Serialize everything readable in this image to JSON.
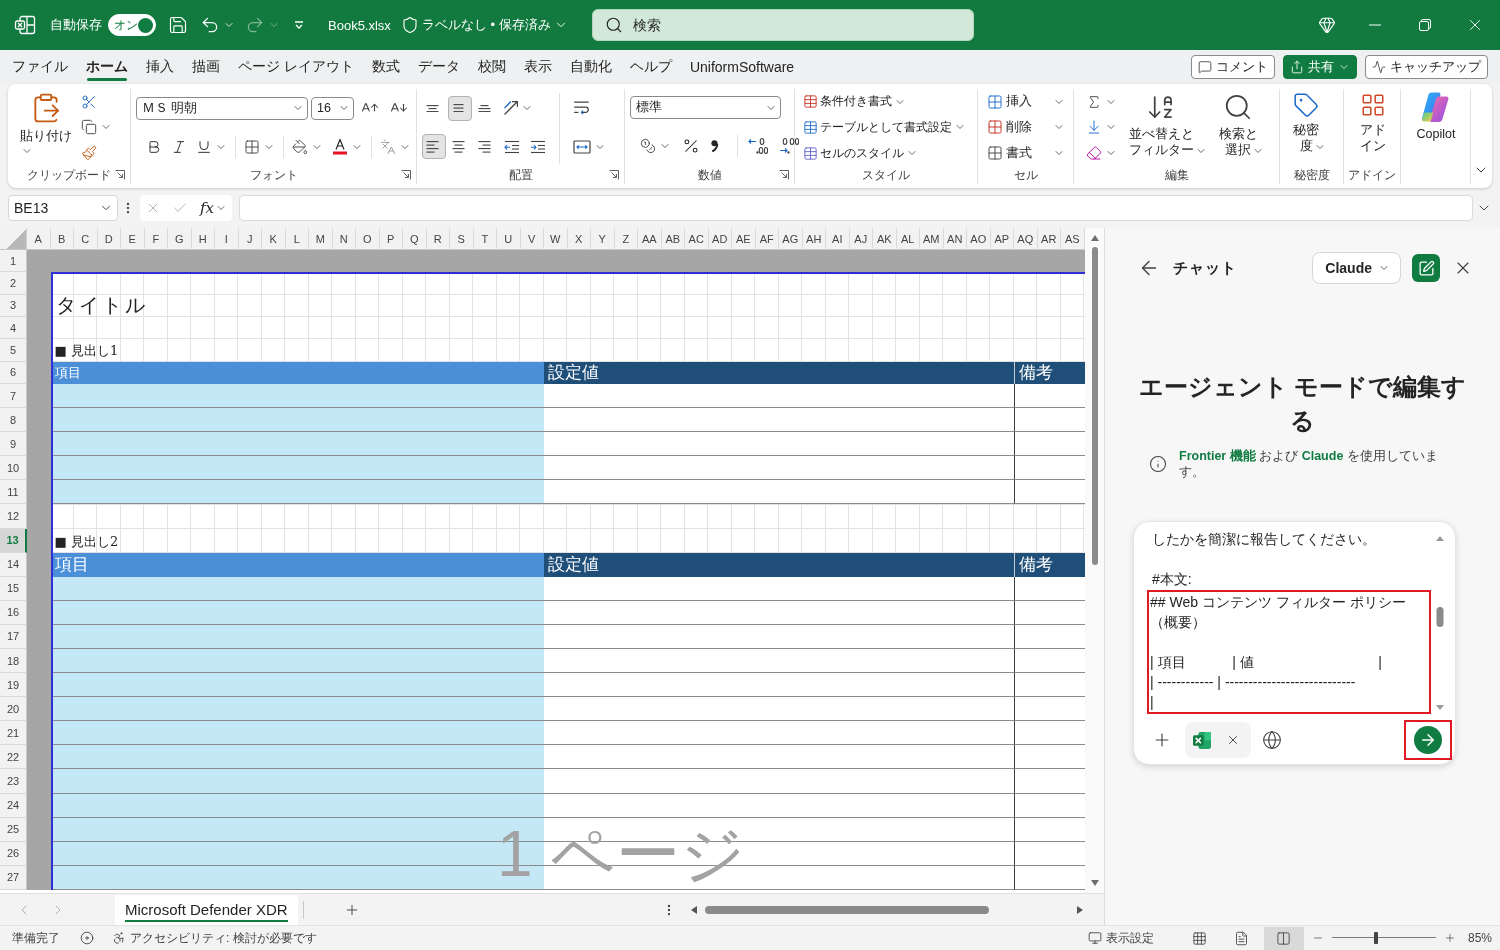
{
  "title_bar": {
    "autosave_label": "自動保存",
    "autosave": {
      "label": "オン",
      "on": true
    },
    "redo": {
      "disabled": true
    },
    "file_name": "Book5.xlsx",
    "file_status": "ラベルなし • 保存済み",
    "search": {
      "placeholder": "検索"
    }
  },
  "ribbon_tabs": [
    {
      "label": "ファイル",
      "selected": false
    },
    {
      "label": "ホーム",
      "selected": true
    },
    {
      "label": "挿入",
      "selected": false
    },
    {
      "label": "描画",
      "selected": false
    },
    {
      "label": "ページ レイアウト",
      "selected": false
    },
    {
      "label": "数式",
      "selected": false
    },
    {
      "label": "データ",
      "selected": false
    },
    {
      "label": "校閲",
      "selected": false
    },
    {
      "label": "表示",
      "selected": false
    },
    {
      "label": "自動化",
      "selected": false
    },
    {
      "label": "ヘルプ",
      "selected": false
    },
    {
      "label": "UniformSoftware",
      "selected": false
    }
  ],
  "header_actions": [
    {
      "label": "コメント",
      "kind": "comment"
    },
    {
      "label": "共有",
      "kind": "share"
    },
    {
      "label": "キャッチアップ",
      "kind": "catchup"
    }
  ],
  "ribbon": {
    "clipboard": {
      "paste": "貼り付け",
      "label": "クリップボード"
    },
    "font": {
      "name": "ＭＳ 明朝",
      "size": "16",
      "label": "フォント"
    },
    "alignment": {
      "vertical": [
        {
          "kind": "top",
          "selected": false
        },
        {
          "kind": "middle",
          "selected": true
        },
        {
          "kind": "bottom",
          "selected": false
        }
      ],
      "horizontal": [
        {
          "kind": "left",
          "selected": true
        },
        {
          "kind": "center",
          "selected": false
        },
        {
          "kind": "right",
          "selected": false
        }
      ],
      "label": "配置"
    },
    "number": {
      "format": "標準",
      "label": "数値"
    },
    "styles": {
      "items": [
        "条件付き書式",
        "テーブルとして書式設定",
        "セルのスタイル"
      ],
      "label": "スタイル"
    },
    "cells": {
      "items": [
        "挿入",
        "削除",
        "書式"
      ],
      "label": "セル"
    },
    "editing": {
      "sort_filter": "並べ替えとフィルター",
      "find_select": "検索と選択",
      "label": "編集"
    },
    "sensitivity": {
      "button": "秘密度",
      "label": "秘密度"
    },
    "addins": {
      "button": "アドイン",
      "label": "アドイン"
    },
    "copilot": {
      "button": "Copilot"
    }
  },
  "formula_bar": {
    "name_box": "BE13",
    "function_label": "fx"
  },
  "sheet": {
    "columns": [
      "A",
      "B",
      "C",
      "D",
      "E",
      "F",
      "G",
      "H",
      "I",
      "J",
      "K",
      "L",
      "M",
      "N",
      "O",
      "P",
      "Q",
      "R",
      "S",
      "T",
      "U",
      "V",
      "W",
      "X",
      "Y",
      "Z",
      "AA",
      "AB",
      "AC",
      "AD",
      "AE",
      "AF",
      "AG",
      "AH",
      "AI",
      "AJ",
      "AK",
      "AL",
      "AM",
      "AN",
      "AO",
      "AP",
      "AQ",
      "AR",
      "AS"
    ],
    "rows": [
      {
        "label": "1",
        "selected": false
      },
      {
        "label": "2",
        "selected": false
      },
      {
        "label": "3",
        "selected": false
      },
      {
        "label": "4",
        "selected": false
      },
      {
        "label": "5",
        "selected": false
      },
      {
        "label": "6",
        "selected": false
      },
      {
        "label": "7",
        "selected": false
      },
      {
        "label": "8",
        "selected": false
      },
      {
        "label": "9",
        "selected": false
      },
      {
        "label": "10",
        "selected": false
      },
      {
        "label": "11",
        "selected": false
      },
      {
        "label": "12",
        "selected": false
      },
      {
        "label": "13",
        "selected": true
      },
      {
        "label": "14",
        "selected": false
      },
      {
        "label": "15",
        "selected": false
      },
      {
        "label": "16",
        "selected": false
      },
      {
        "label": "17",
        "selected": false
      },
      {
        "label": "18",
        "selected": false
      },
      {
        "label": "19",
        "selected": false
      },
      {
        "label": "20",
        "selected": false
      },
      {
        "label": "21",
        "selected": false
      },
      {
        "label": "22",
        "selected": false
      },
      {
        "label": "23",
        "selected": false
      },
      {
        "label": "24",
        "selected": false
      },
      {
        "label": "25",
        "selected": false
      },
      {
        "label": "26",
        "selected": false
      },
      {
        "label": "27",
        "selected": false
      }
    ],
    "title": "タイトル",
    "sections": [
      {
        "heading": "■ 見出し1",
        "columns": [
          {
            "label": "項目",
            "kind": "key"
          },
          {
            "label": "設定値",
            "kind": "value"
          },
          {
            "label": "備考",
            "kind": "note"
          }
        ]
      },
      {
        "heading": "■ 見出し2",
        "columns": [
          {
            "label": "項目",
            "kind": "key"
          },
          {
            "label": "設定値",
            "kind": "value"
          },
          {
            "label": "備考",
            "kind": "note"
          }
        ]
      }
    ],
    "page_label": "1 ページ"
  },
  "sheet_tabs": [
    {
      "label": "Microsoft Defender XDR",
      "selected": true
    }
  ],
  "chat": {
    "title": "チャット",
    "model": "Claude",
    "heading": "エージェント モードで編集する",
    "notice": [
      {
        "text": "Frontier 機能",
        "kind": "link"
      },
      {
        "text": " および ",
        "kind": "text"
      },
      {
        "text": "Claude",
        "kind": "link"
      },
      {
        "text": " を使用しています。",
        "kind": "text"
      }
    ],
    "prompt": {
      "lines": [
        {
          "kind": "text",
          "text": "したかを簡潔に報告してください。"
        },
        {
          "kind": "blank"
        },
        {
          "kind": "text",
          "text": "#本文:"
        }
      ],
      "highlighted": true,
      "highlighted_lines": [
        {
          "kind": "text",
          "text": "## Web コンテンツ フィルター ポリシー（概要）"
        },
        {
          "kind": "blank"
        },
        {
          "kind": "text",
          "text": "| 項目            | 値                                |"
        },
        {
          "kind": "text",
          "text": "| ------------ | ----------------------------"
        },
        {
          "kind": "text",
          "text": "|"
        }
      ]
    },
    "send": {
      "highlighted": true
    }
  },
  "status_bar": {
    "ready": "準備完了",
    "accessibility": "アクセシビリティ: 検討が必要です",
    "display_settings": "表示設定",
    "views": [
      {
        "kind": "normal",
        "selected": false
      },
      {
        "kind": "page_layout",
        "selected": false
      },
      {
        "kind": "page_break",
        "selected": true
      }
    ],
    "zoom": {
      "level": 0.42,
      "reading": "85%"
    }
  }
}
